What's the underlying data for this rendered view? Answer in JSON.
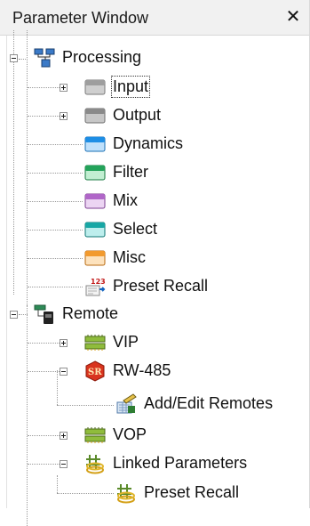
{
  "window": {
    "title": "Parameter Window",
    "close_glyph": "✕"
  },
  "tree": {
    "processing": {
      "label": "Processing",
      "icon": "processing-tree-icon",
      "items": [
        {
          "label": "Input",
          "icon": "folder-gray-icon",
          "color": "#9e9e9e",
          "expandable": true,
          "selected": true
        },
        {
          "label": "Output",
          "icon": "folder-gray-icon",
          "color": "#8a8a8a",
          "expandable": true
        },
        {
          "label": "Dynamics",
          "icon": "folder-blue-icon",
          "color": "#1e8ee5"
        },
        {
          "label": "Filter",
          "icon": "folder-green-icon",
          "color": "#23a35a"
        },
        {
          "label": "Mix",
          "icon": "folder-purple-icon",
          "color": "#b066c8"
        },
        {
          "label": "Select",
          "icon": "folder-teal-icon",
          "color": "#17a7a5"
        },
        {
          "label": "Misc",
          "icon": "folder-orange-icon",
          "color": "#f29a2e"
        },
        {
          "label": "Preset Recall",
          "icon": "preset-recall-icon",
          "badge": "123"
        }
      ]
    },
    "remote": {
      "label": "Remote",
      "icon": "remote-tree-icon",
      "items": [
        {
          "label": "VIP",
          "icon": "vip-board-icon",
          "expandable": true
        },
        {
          "label": "RW-485",
          "icon": "rw485-sr-icon",
          "badge": "SR",
          "expanded": true,
          "children": [
            {
              "label": "Add/Edit Remotes",
              "icon": "add-edit-remotes-icon"
            }
          ]
        },
        {
          "label": "VOP",
          "icon": "vop-board-icon",
          "expandable": true
        },
        {
          "label": "Linked Parameters",
          "icon": "linked-parameters-icon",
          "expanded": true,
          "children": [
            {
              "label": "Preset Recall",
              "icon": "linked-preset-recall-icon"
            }
          ]
        }
      ]
    }
  }
}
